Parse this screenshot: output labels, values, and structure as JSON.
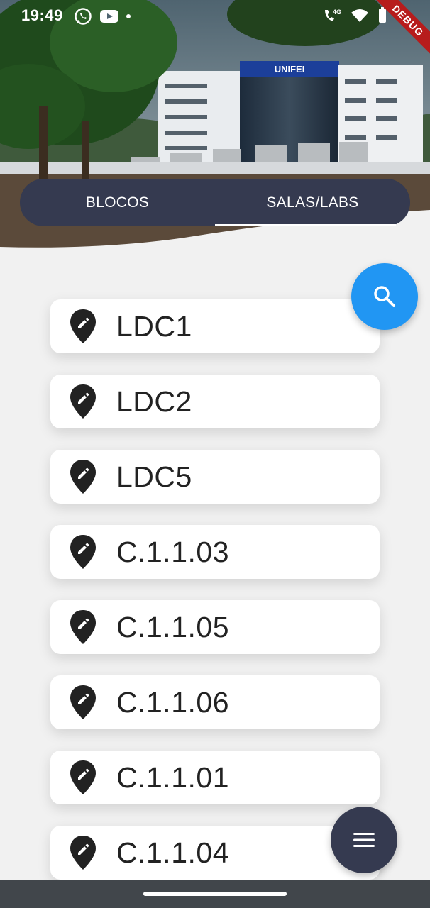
{
  "status_bar": {
    "time": "19:49",
    "left_icons": [
      "whatsapp-icon",
      "youtube-icon",
      "notification-dot"
    ],
    "right_icons": [
      "call-4g-icon",
      "wifi-icon",
      "battery-icon"
    ],
    "debug_banner": "DEBUG"
  },
  "header": {
    "building_sign": "UNIFEI",
    "background": "university campus photo"
  },
  "tabs": [
    {
      "label": "BLOCOS",
      "active": false
    },
    {
      "label": "SALAS/LABS",
      "active": true
    }
  ],
  "search_button": {
    "icon": "search-icon",
    "color": "#2196f3"
  },
  "rooms": [
    {
      "name": "LDC1",
      "icon": "edit-location-icon"
    },
    {
      "name": "LDC2",
      "icon": "edit-location-icon"
    },
    {
      "name": "LDC5",
      "icon": "edit-location-icon"
    },
    {
      "name": "C.1.1.03",
      "icon": "edit-location-icon"
    },
    {
      "name": "C.1.1.05",
      "icon": "edit-location-icon"
    },
    {
      "name": "C.1.1.06",
      "icon": "edit-location-icon"
    },
    {
      "name": "C.1.1.01",
      "icon": "edit-location-icon"
    },
    {
      "name": "C.1.1.04",
      "icon": "edit-location-icon"
    }
  ],
  "menu_button": {
    "icon": "menu-icon",
    "color": "#353a50"
  },
  "colors": {
    "accent": "#2196f3",
    "tabbar": "#353a50",
    "background": "#f1f1f1",
    "navbar": "#41464b"
  }
}
